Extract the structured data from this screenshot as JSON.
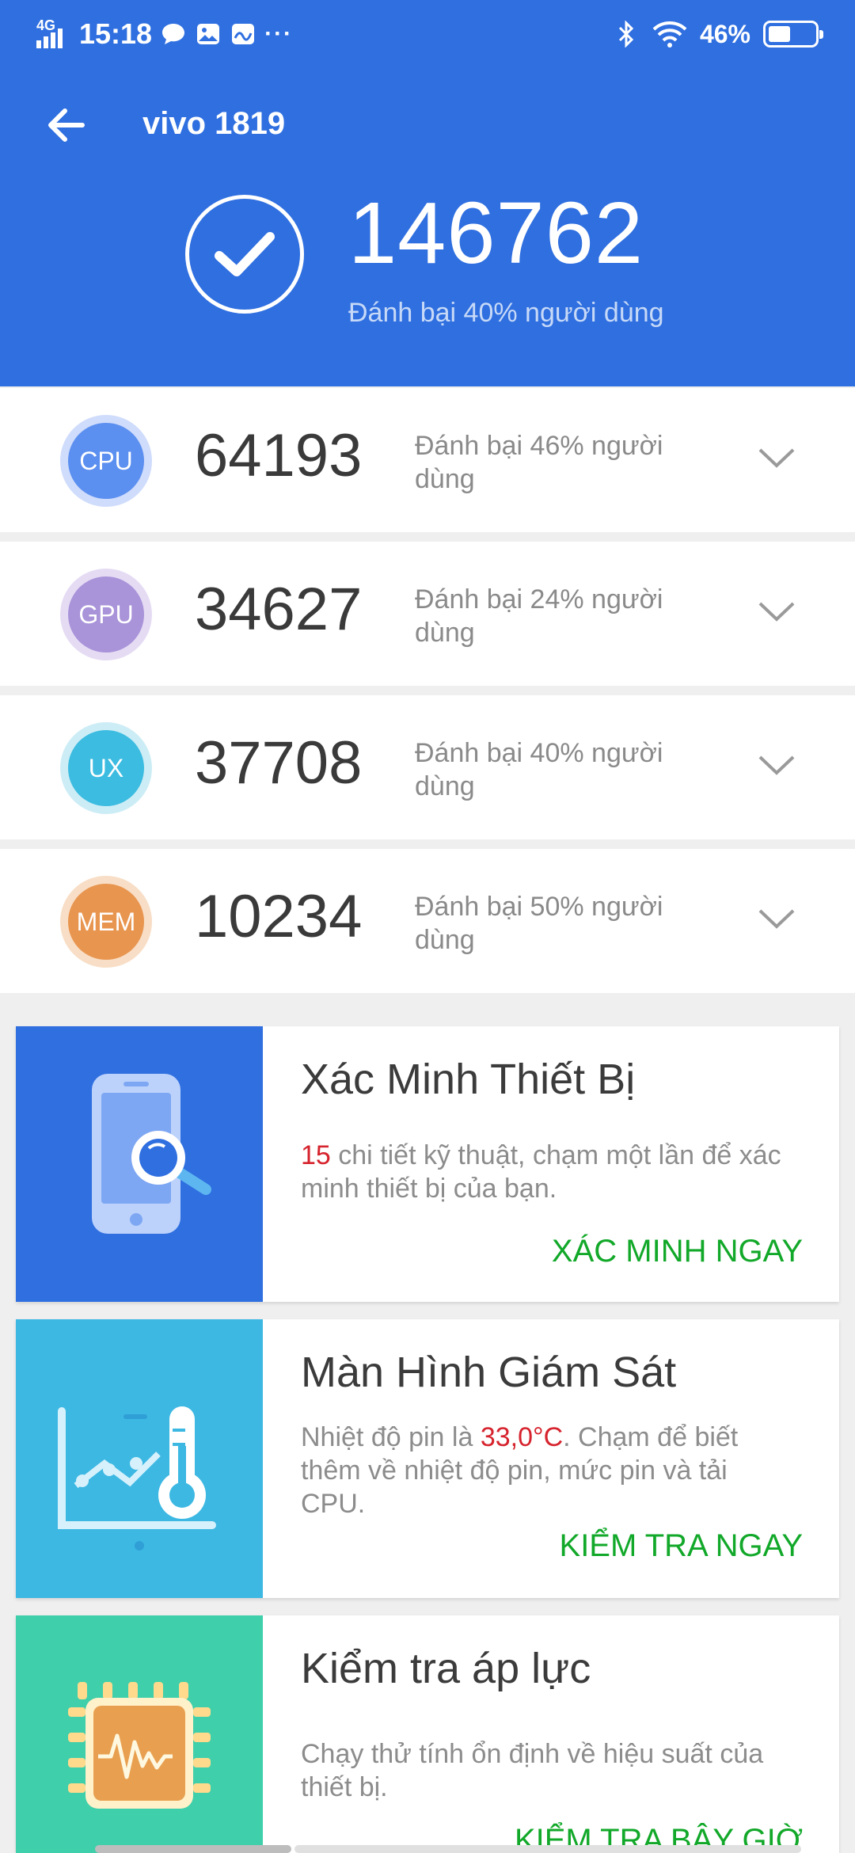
{
  "status_bar": {
    "network": "4G",
    "time": "15:18",
    "more": "···",
    "battery_text": "46%",
    "battery_level": 0.46
  },
  "header": {
    "device_name": "vivo 1819",
    "total_score": "146762",
    "total_beat": "Đánh bại 40% người dùng"
  },
  "scores": [
    {
      "label": "CPU",
      "score": "64193",
      "beat": "Đánh bại 46% người dùng",
      "color": "#5b8ff0",
      "ring": "#cfdcfb"
    },
    {
      "label": "GPU",
      "score": "34627",
      "beat": "Đánh bại 24% người dùng",
      "color": "#a993d9",
      "ring": "#e5dcf4"
    },
    {
      "label": "UX",
      "score": "37708",
      "beat": "Đánh bại 40% người dùng",
      "color": "#3bbce0",
      "ring": "#cdedf6"
    },
    {
      "label": "MEM",
      "score": "10234",
      "beat": "Đánh bại 50% người dùng",
      "color": "#e8954f",
      "ring": "#f8dec6"
    }
  ],
  "cards": {
    "verify": {
      "title": "Xác Minh Thiết Bị",
      "desc_num": "15",
      "desc_text": " chi tiết kỹ thuật, chạm một lần để xác minh thiết bị của bạn.",
      "action": "XÁC MINH NGAY",
      "color": "#2f6fe0"
    },
    "monitor": {
      "title": "Màn Hình Giám Sát",
      "desc_pre": "Nhiệt độ pin là ",
      "desc_temp": "33,0°C",
      "desc_post": ". Chạm để biết thêm về nhiệt độ pin, mức pin và tải CPU.",
      "action": "KIỂM TRA NGAY",
      "color": "#3db8e3"
    },
    "stress": {
      "title": "Kiểm tra áp lực",
      "desc": "Chạy thử tính ổn định về hiệu suất của thiết bị.",
      "action": "KIỂM TRA BÂY GIỜ",
      "color": "#3fcfaa"
    }
  }
}
